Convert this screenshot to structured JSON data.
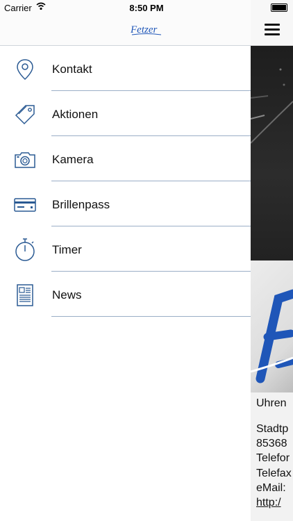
{
  "status_bar": {
    "carrier": "Carrier",
    "time": "8:50 PM"
  },
  "drawer": {
    "brand": "Fetzer",
    "items": [
      {
        "label": "Kontakt",
        "icon": "location-pin-icon"
      },
      {
        "label": "Aktionen",
        "icon": "tag-icon"
      },
      {
        "label": "Kamera",
        "icon": "camera-icon"
      },
      {
        "label": "Brillenpass",
        "icon": "card-icon"
      },
      {
        "label": "Timer",
        "icon": "stopwatch-icon"
      },
      {
        "label": "News",
        "icon": "newspaper-icon"
      }
    ]
  },
  "content": {
    "menu_icon": "hamburger-icon",
    "lines": [
      "Uhren",
      "Stadtp",
      "85368",
      "Telefor",
      "Telefax",
      "eMail:",
      "http:/"
    ]
  },
  "colors": {
    "icon_blue": "#2a5a93",
    "separator": "#9aaec6",
    "brand_blue": "#1f56b8"
  }
}
